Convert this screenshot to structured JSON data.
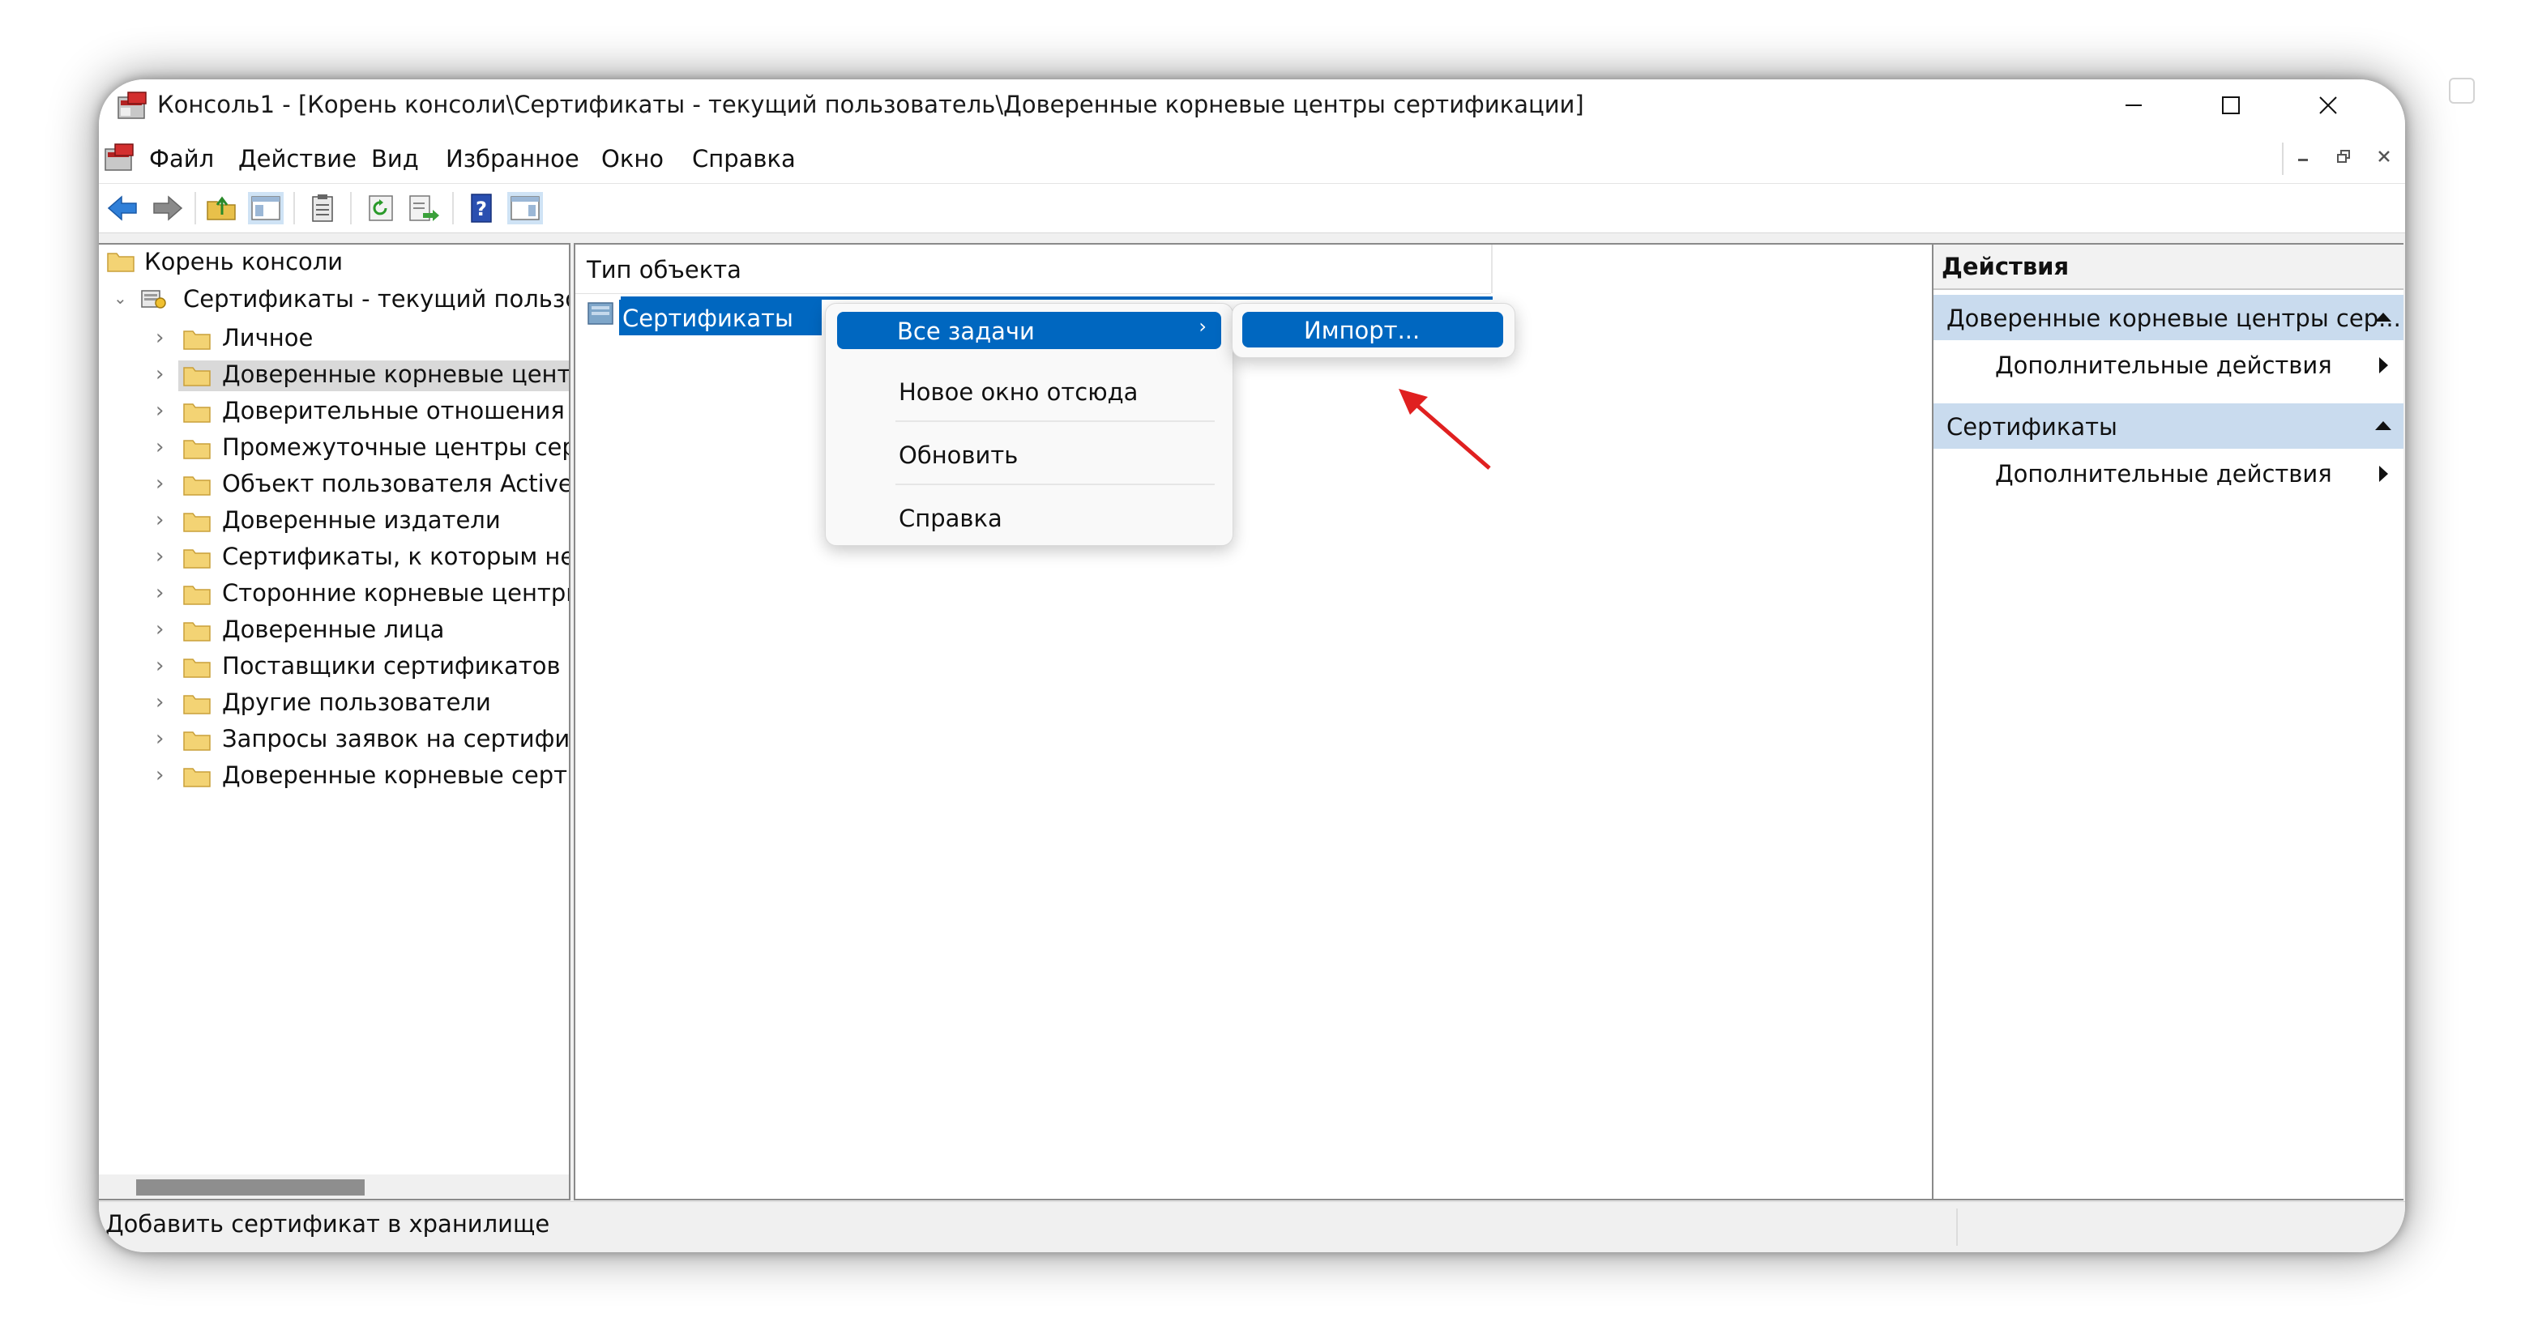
{
  "window": {
    "title": "Консоль1 - [Корень консоли\\Сертификаты - текущий пользователь\\Доверенные корневые центры сертификации]"
  },
  "menu": [
    "Файл",
    "Действие",
    "Вид",
    "Избранное",
    "Окно",
    "Справка"
  ],
  "tree": {
    "root": "Корень консоли",
    "store": "Сертификаты - текущий пользоват",
    "items": [
      "Личное",
      "Доверенные корневые центры",
      "Доверительные отношения в п",
      "Промежуточные центры серти",
      "Объект пользователя Active Di",
      "Доверенные издатели",
      "Сертификаты, к которым нет до",
      "Сторонние корневые центры с",
      "Доверенные лица",
      "Поставщики сертификатов про",
      "Другие пользователи",
      "Запросы заявок на сертификат",
      "Доверенные корневые сертиф"
    ],
    "selected_index": 1
  },
  "center": {
    "column_header": "Тип объекта",
    "selected_row": "Сертификаты"
  },
  "context_menu": {
    "items": [
      "Все задачи",
      "Новое окно отсюда",
      "Обновить",
      "Справка"
    ],
    "submenu_arrow": "›",
    "submenu": [
      "Импорт..."
    ]
  },
  "actions": {
    "title": "Действия",
    "groups": [
      {
        "label": "Доверенные корневые центры сер...",
        "item": "Дополнительные действия"
      },
      {
        "label": "Сертификаты",
        "item": "Дополнительные действия"
      }
    ]
  },
  "statusbar": {
    "text": "Добавить сертификат в хранилище"
  },
  "colors": {
    "accent": "#0067c0",
    "group_bg": "#c9dbee",
    "annotation_arrow": "#e02020"
  },
  "icons": {
    "window": [
      "app-mmc-icon",
      "minimize-icon",
      "maximize-icon",
      "close-icon"
    ],
    "toolbar": [
      "back-icon",
      "forward-icon",
      "up-folder-icon",
      "show-hide-tree-icon",
      "clipboard-icon",
      "refresh-icon",
      "export-list-icon",
      "help-icon",
      "action-pane-icon"
    ]
  }
}
